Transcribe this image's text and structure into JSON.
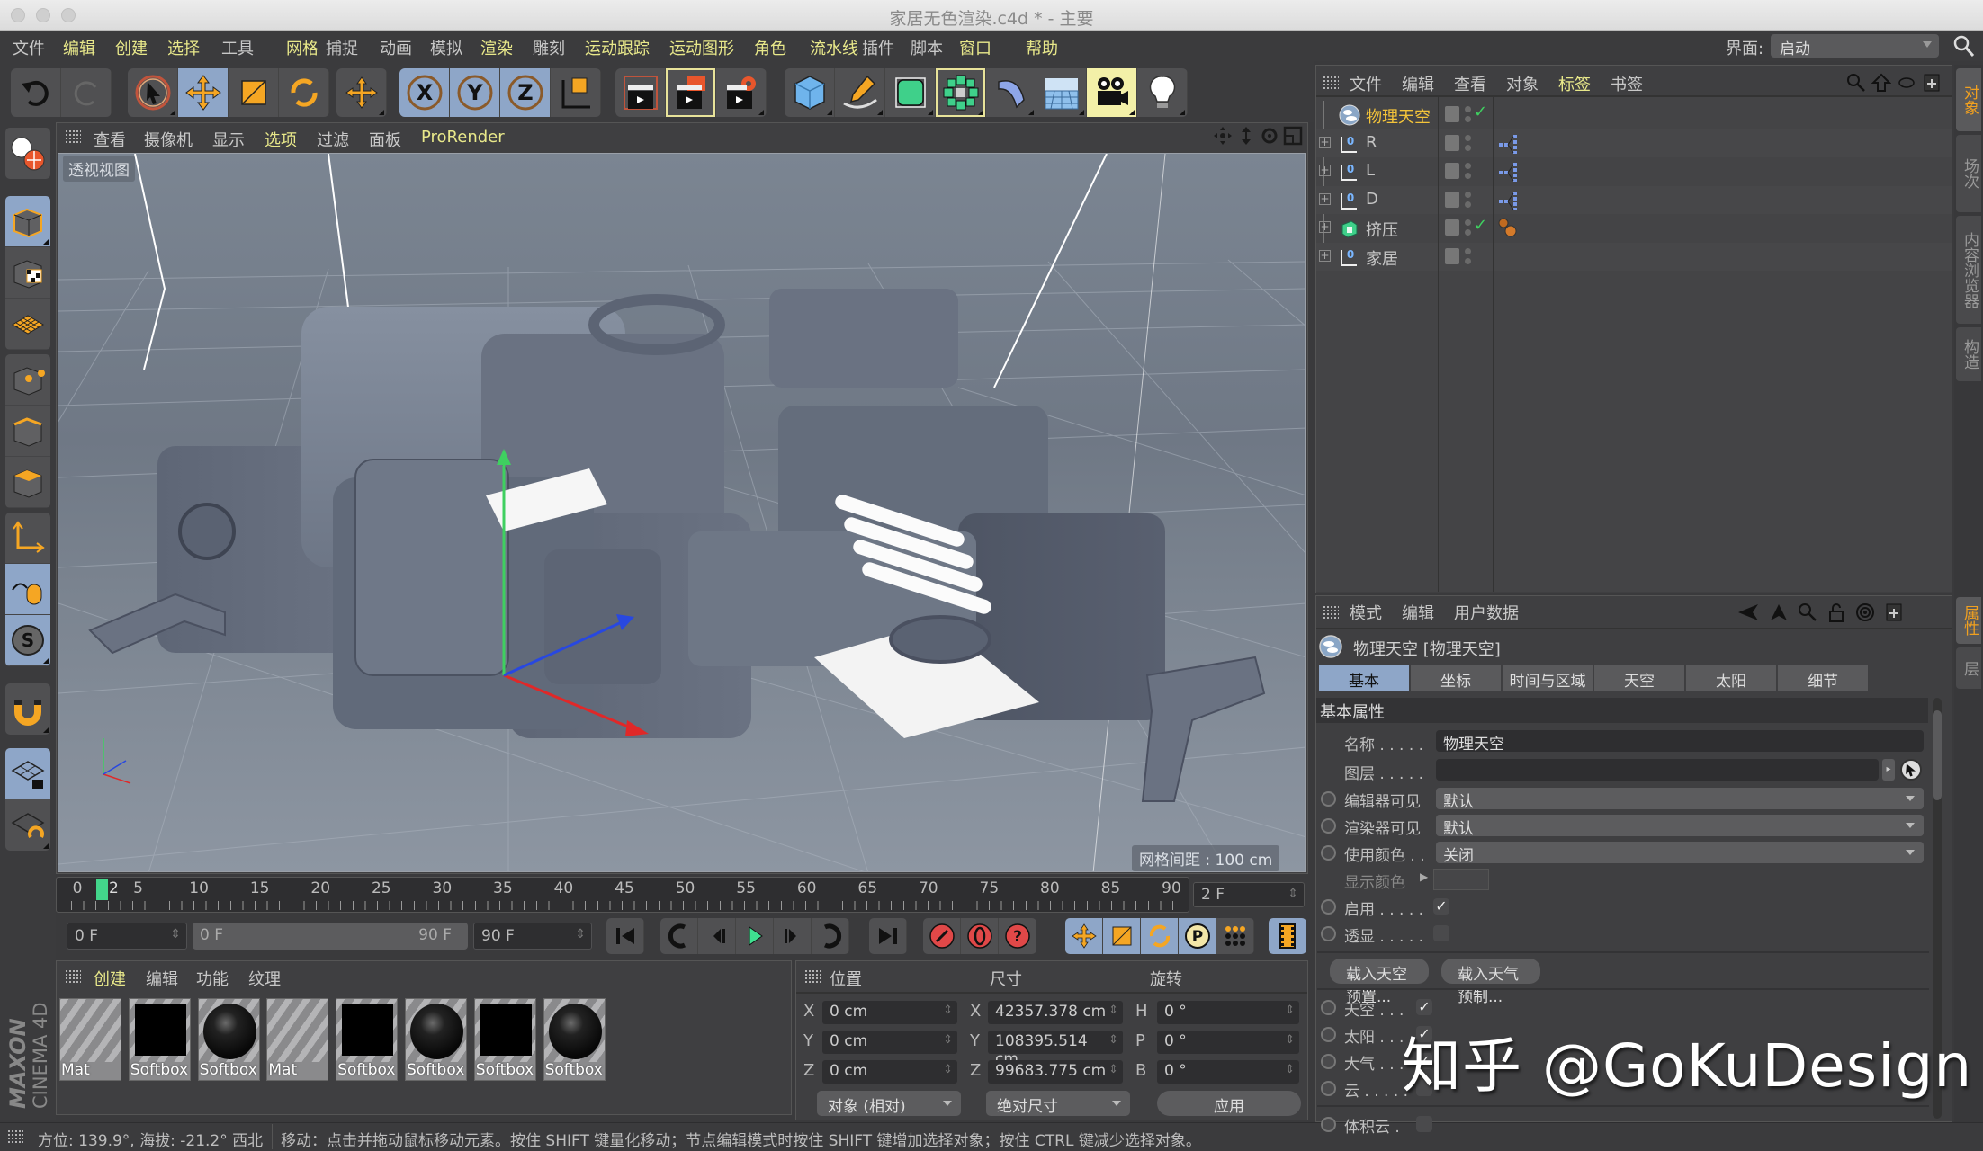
{
  "window": {
    "title": "家居无色渲染.c4d * - 主要"
  },
  "menu": {
    "items": [
      {
        "label": "文件",
        "hl": false
      },
      {
        "label": "编辑",
        "hl": true
      },
      {
        "label": "创建",
        "hl": true
      },
      {
        "label": "选择",
        "hl": true
      },
      {
        "label": "工具",
        "hl": false
      },
      {
        "label": "网格",
        "hl": true
      },
      {
        "label": "捕捉",
        "hl": false
      },
      {
        "label": "动画",
        "hl": false
      },
      {
        "label": "模拟",
        "hl": false
      },
      {
        "label": "渲染",
        "hl": true
      },
      {
        "label": "雕刻",
        "hl": false
      },
      {
        "label": "运动跟踪",
        "hl": true
      },
      {
        "label": "运动图形",
        "hl": true
      },
      {
        "label": "角色",
        "hl": true
      },
      {
        "label": "流水线",
        "hl": true
      },
      {
        "label": "插件",
        "hl": false
      },
      {
        "label": "脚本",
        "hl": false
      },
      {
        "label": "窗口",
        "hl": true
      },
      {
        "label": "帮助",
        "hl": true
      }
    ],
    "interface_label": "界面:",
    "interface_value": "启动"
  },
  "toolbar": {
    "icons": [
      "undo-icon",
      "redo-icon",
      "live-selection-icon",
      "move-icon",
      "scale-icon",
      "rotate-icon",
      "last-tool-icon",
      "x-axis-lock-icon",
      "y-axis-lock-icon",
      "z-axis-lock-icon",
      "coordinate-system-icon",
      "render-view-icon",
      "render-to-picture-viewer-icon",
      "render-settings-icon",
      "cube-icon",
      "pen-spline-icon",
      "subdivision-surface-icon",
      "cloner-icon",
      "deformer-icon",
      "floor-icon",
      "camera-icon",
      "light-icon"
    ]
  },
  "viewport": {
    "menu": [
      {
        "label": "查看",
        "hl": false
      },
      {
        "label": "摄像机",
        "hl": false
      },
      {
        "label": "显示",
        "hl": false
      },
      {
        "label": "选项",
        "hl": true
      },
      {
        "label": "过滤",
        "hl": false
      },
      {
        "label": "面板",
        "hl": false
      },
      {
        "label": "ProRender",
        "hl": true
      }
    ],
    "view_name": "透视视图",
    "grid_spacing": "网格间距 : 100 cm"
  },
  "timeline": {
    "ticks": [
      "0",
      "5",
      "10",
      "15",
      "20",
      "25",
      "30",
      "35",
      "40",
      "45",
      "50",
      "55",
      "60",
      "65",
      "70",
      "75",
      "80",
      "85",
      "90"
    ],
    "current_frame_marker": "2",
    "current_frame": 2,
    "frame_field": "2 F",
    "start_field": "0 F",
    "range_start": "0 F",
    "range_end": "90 F",
    "end_field": "90 F"
  },
  "materials": {
    "menu": [
      {
        "label": "创建",
        "hl": true
      },
      {
        "label": "编辑",
        "hl": false
      },
      {
        "label": "功能",
        "hl": false
      },
      {
        "label": "纹理",
        "hl": false
      }
    ],
    "items": [
      {
        "name": "Mat",
        "preview": "stripes"
      },
      {
        "name": "Softbox",
        "preview": "square"
      },
      {
        "name": "Softbox",
        "preview": "sphere"
      },
      {
        "name": "Mat",
        "preview": "stripes"
      },
      {
        "name": "Softbox",
        "preview": "square"
      },
      {
        "name": "Softbox",
        "preview": "sphere"
      },
      {
        "name": "Softbox",
        "preview": "square"
      },
      {
        "name": "Softbox",
        "preview": "sphere"
      }
    ],
    "brand": "MAXON CINEMA 4D"
  },
  "coordinates": {
    "headers": {
      "position": "位置",
      "size": "尺寸",
      "rotation": "旋转"
    },
    "position": [
      {
        "axis": "X",
        "value": "0 cm"
      },
      {
        "axis": "Y",
        "value": "0 cm"
      },
      {
        "axis": "Z",
        "value": "0 cm"
      }
    ],
    "size": [
      {
        "axis": "X",
        "value": "42357.378 cm"
      },
      {
        "axis": "Y",
        "value": "108395.514 cm"
      },
      {
        "axis": "Z",
        "value": "99683.775 cm"
      }
    ],
    "rotation": [
      {
        "axis": "H",
        "value": "0 °"
      },
      {
        "axis": "P",
        "value": "0 °"
      },
      {
        "axis": "B",
        "value": "0 °"
      }
    ],
    "mode_dropdown": "对象 (相对)",
    "size_dropdown": "绝对尺寸",
    "apply_label": "应用"
  },
  "status": {
    "left": "方位: 139.9°, 海拔: -21.2°  西北",
    "right": "移动：点击并拖动鼠标移动元素。按住 SHIFT 键量化移动；节点编辑模式时按住 SHIFT 键增加选择对象；按住 CTRL 键减少选择对象。"
  },
  "object_manager": {
    "menu": [
      {
        "label": "文件",
        "hl": false
      },
      {
        "label": "编辑",
        "hl": false
      },
      {
        "label": "查看",
        "hl": false
      },
      {
        "label": "对象",
        "hl": false
      },
      {
        "label": "标签",
        "hl": true
      },
      {
        "label": "书签",
        "hl": false
      }
    ],
    "objects": [
      {
        "name": "物理天空",
        "icon": "physical-sky-icon",
        "selected": true,
        "expandable": false,
        "enabled_check": true,
        "tag": ""
      },
      {
        "name": "R",
        "icon": "null-object-icon",
        "selected": false,
        "expandable": true,
        "enabled_check": false,
        "tag": "hierarchy-tag-icon"
      },
      {
        "name": "L",
        "icon": "null-object-icon",
        "selected": false,
        "expandable": true,
        "enabled_check": false,
        "tag": "hierarchy-tag-icon"
      },
      {
        "name": "D",
        "icon": "null-object-icon",
        "selected": false,
        "expandable": true,
        "enabled_check": false,
        "tag": "hierarchy-tag-icon"
      },
      {
        "name": "挤压",
        "icon": "extrude-icon",
        "selected": false,
        "expandable": true,
        "enabled_check": true,
        "tag": "material-tag-icon"
      },
      {
        "name": "家居",
        "icon": "null-object-icon",
        "selected": false,
        "expandable": true,
        "enabled_check": false,
        "tag": ""
      }
    ]
  },
  "side_tabs": {
    "top": [
      {
        "label": "对象",
        "active": true
      },
      {
        "label": "场次",
        "active": false
      },
      {
        "label": "内容浏览器",
        "active": false
      },
      {
        "label": "构造",
        "active": false
      }
    ],
    "bottom": [
      {
        "label": "属性",
        "active": true
      },
      {
        "label": "层",
        "active": false
      }
    ]
  },
  "attributes": {
    "menu": [
      "模式",
      "编辑",
      "用户数据"
    ],
    "title": "物理天空 [物理天空]",
    "tabs": [
      {
        "label": "基本",
        "active": true
      },
      {
        "label": "坐标",
        "active": false
      },
      {
        "label": "时间与区域",
        "active": false
      },
      {
        "label": "天空",
        "active": false
      },
      {
        "label": "太阳",
        "active": false
      },
      {
        "label": "细节",
        "active": false
      }
    ],
    "section": "基本属性",
    "name_label": "名称 . . . . .",
    "name_value": "物理天空",
    "layer_label": "图层 . . . . .",
    "layer_value": "",
    "editor_visible_label": "编辑器可见",
    "editor_visible_value": "默认",
    "render_visible_label": "渲染器可见",
    "render_visible_value": "默认",
    "use_color_label": "使用颜色 . .",
    "use_color_value": "关闭",
    "display_color_label": "显示颜色",
    "enable_label": "启用 . . . . .",
    "enable_checked": true,
    "xray_label": "透显 . . . . .",
    "xray_checked": false,
    "load_sky_preset": "载入天空预置...",
    "load_weather_preset": "载入天气预制...",
    "sky_label": "天空 . . .",
    "sky_checked": true,
    "sun_label": "太阳 . . .",
    "sun_checked": true,
    "atmosphere_label": "大气 . . .",
    "atmosphere_checked": true,
    "clouds_label": "云 . . . . .",
    "clouds_checked": false,
    "volumetric_clouds_label": "体积云 .",
    "volumetric_clouds_checked": false
  },
  "watermark": "知乎 @GoKuDesign"
}
